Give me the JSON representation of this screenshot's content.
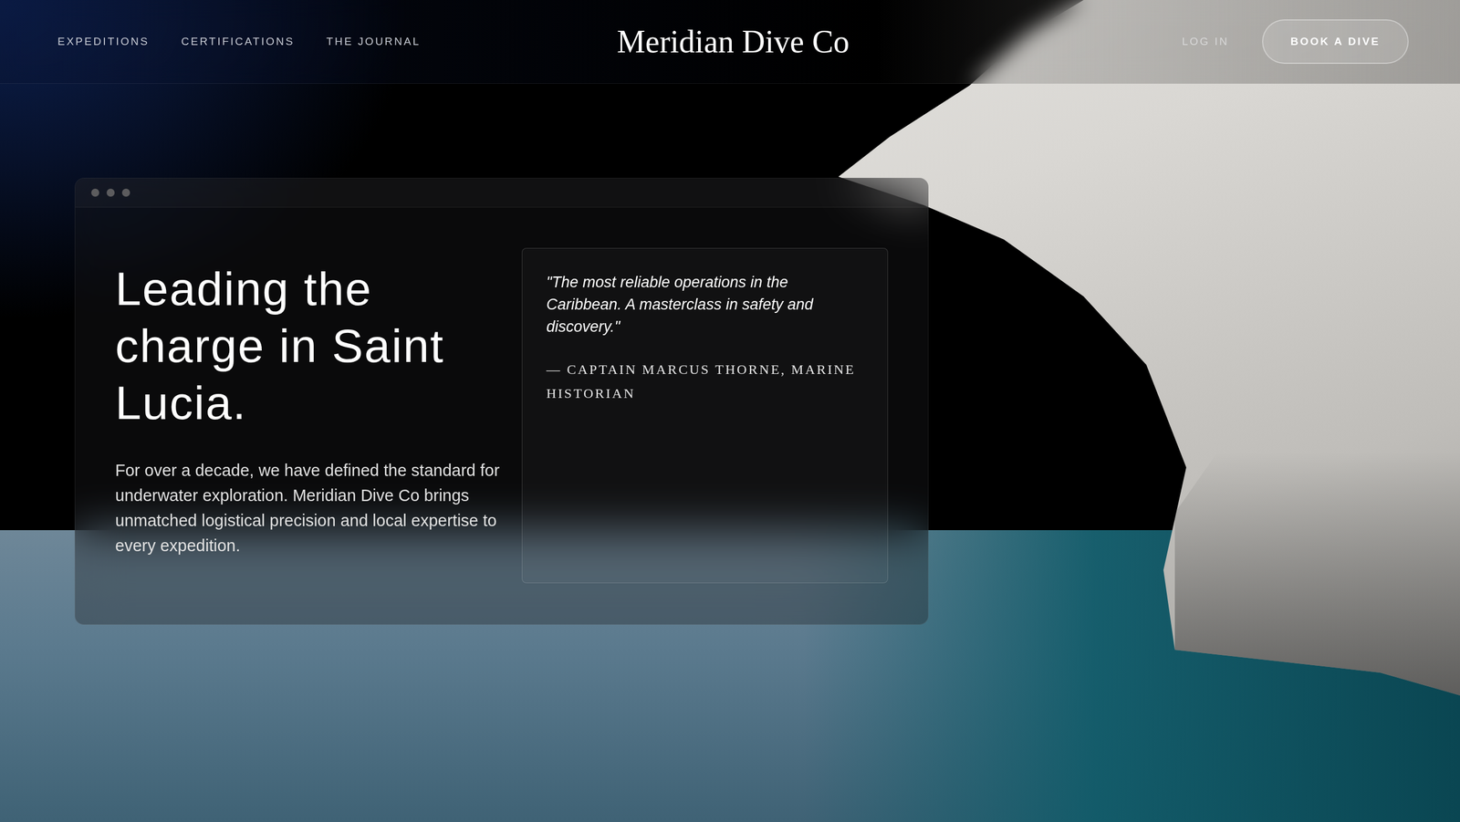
{
  "nav": {
    "links": [
      "EXPEDITIONS",
      "CERTIFICATIONS",
      "THE JOURNAL"
    ],
    "logo": "Meridian Dive Co",
    "login": "LOG IN",
    "cta": "BOOK A DIVE"
  },
  "hero": {
    "heading": "Leading the charge in Saint Lucia.",
    "body": "For over a decade, we have defined the standard for underwater exploration. Meridian Dive Co brings unmatched logistical precision and local expertise to every expedition.",
    "quote": "\"The most reliable operations in the Caribbean. A masterclass in safety and discovery.\"",
    "attribution": "— CAPTAIN MARCUS THORNE, MARINE HISTORIAN"
  }
}
